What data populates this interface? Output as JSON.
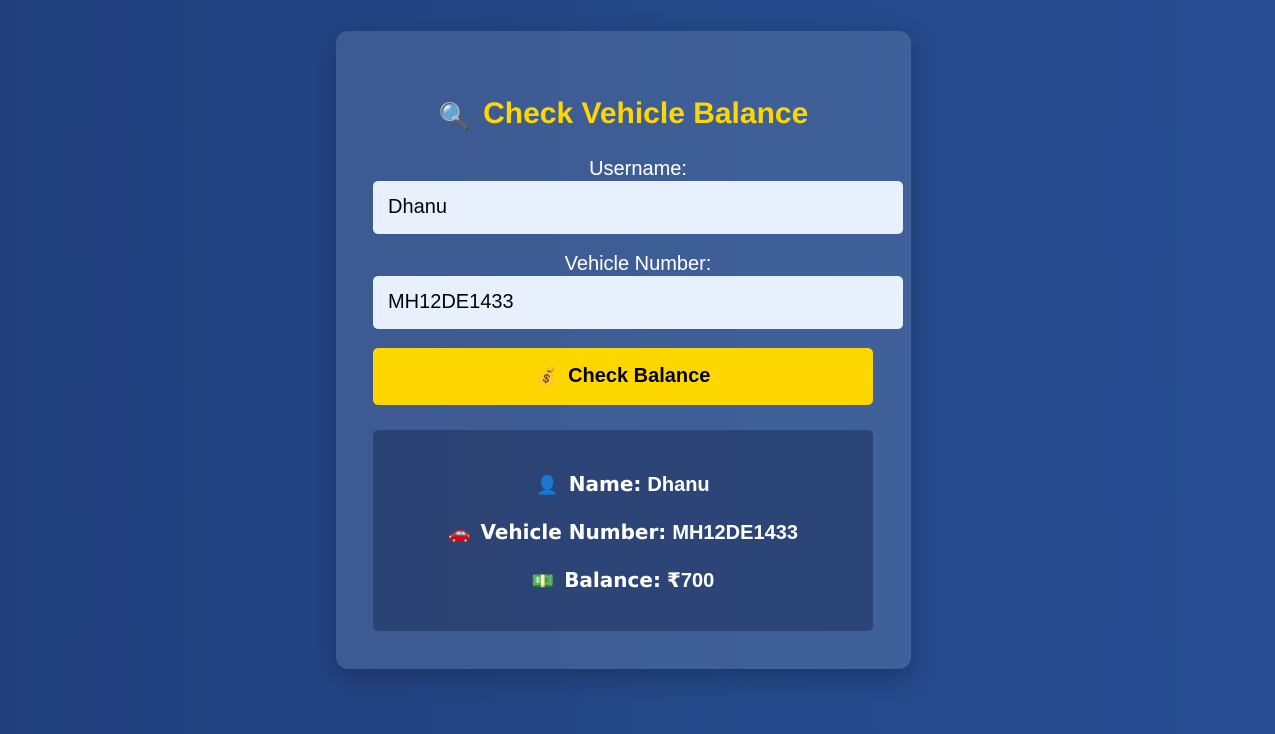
{
  "form": {
    "title_icon": "🔍",
    "title": "Check Vehicle Balance",
    "username_label": "Username:",
    "username_value": "Dhanu",
    "vehicle_label": "Vehicle Number:",
    "vehicle_value": "MH12DE1433",
    "button_icon": "💰",
    "button_label": "Check Balance"
  },
  "result": {
    "name_icon": "👤",
    "name_label": "Name:",
    "name_value": "Dhanu",
    "vehicle_icon": "🚗",
    "vehicle_label": "Vehicle Number:",
    "vehicle_value": "MH12DE1433",
    "balance_icon": "💵",
    "balance_label": "Balance:",
    "balance_value": "₹700"
  },
  "colors": {
    "accent": "#ffd700",
    "input_bg": "#e8f0fe",
    "text": "#ffffff"
  }
}
